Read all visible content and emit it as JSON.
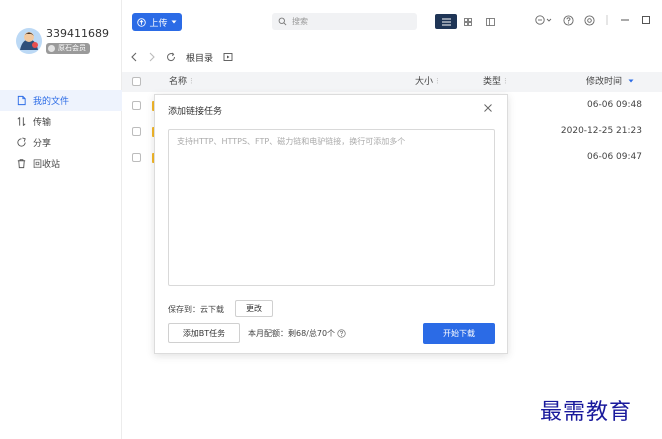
{
  "user": {
    "name": "339411689",
    "badge": "原石会员"
  },
  "sidebar": {
    "items": [
      {
        "label": "我的文件",
        "icon": "file-icon"
      },
      {
        "label": "传输",
        "icon": "transfer-icon"
      },
      {
        "label": "分享",
        "icon": "share-icon"
      },
      {
        "label": "回收站",
        "icon": "trash-icon"
      }
    ]
  },
  "toolbar": {
    "upload_label": "上传",
    "search_placeholder": "搜索"
  },
  "breadcrumb": {
    "root": "根目录"
  },
  "table": {
    "columns": {
      "name": "名称",
      "size": "大小",
      "type": "类型",
      "modified": "修改时间"
    },
    "rows": [
      {
        "modified": "06-06 09:48"
      },
      {
        "modified": "2020-12-25 21:23"
      },
      {
        "modified": "06-06 09:47"
      }
    ]
  },
  "dialog": {
    "title": "添加链接任务",
    "placeholder": "支持HTTP、HTTPS、FTP、磁力链和电驴链接，换行可添加多个",
    "save_to": "保存到：云下载",
    "change_label": "更改",
    "bt_label": "添加BT任务",
    "quota": "本月配额：剩68/总70个",
    "start_label": "开始下载"
  },
  "watermark": "最需教育",
  "colors": {
    "accent": "#2b6be6",
    "folder": "#f4b82a",
    "view_active": "#1f3556"
  }
}
